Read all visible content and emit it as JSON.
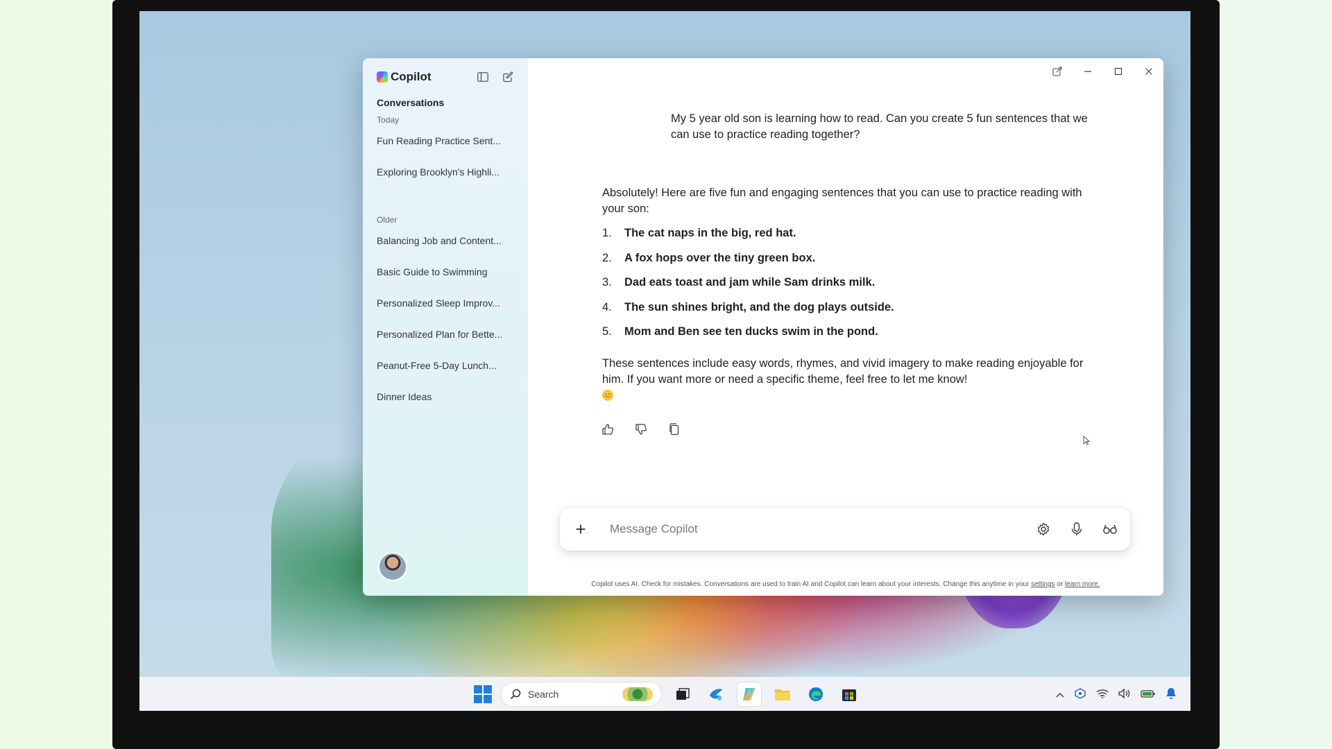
{
  "app": {
    "title": "Copilot"
  },
  "sidebar": {
    "heading": "Conversations",
    "groups": [
      {
        "label": "Today",
        "items": [
          "Fun Reading Practice Sent...",
          "Exploring Brooklyn's Highli..."
        ]
      },
      {
        "label": "Older",
        "items": [
          "Balancing Job and Content...",
          "Basic Guide to Swimming",
          "Personalized Sleep Improv...",
          "Personalized Plan for Bette...",
          "Peanut-Free 5-Day Lunch...",
          "Dinner Ideas"
        ]
      }
    ]
  },
  "chat": {
    "user_message": "My 5 year old son is learning how to read. Can you create 5 fun sentences that we can use to practice reading together?",
    "reply_intro": "Absolutely! Here are five fun and engaging sentences that you can use to practice reading with your son:",
    "sentences": [
      {
        "num": "1.",
        "text": "The cat naps in the big, red hat."
      },
      {
        "num": "2.",
        "text": "A fox hops over the tiny green box."
      },
      {
        "num": "3.",
        "text": "Dad eats toast and jam while Sam drinks milk."
      },
      {
        "num": "4.",
        "text": "The sun shines bright, and the dog plays outside."
      },
      {
        "num": "5.",
        "text": "Mom and Ben see ten ducks swim in the pond."
      }
    ],
    "reply_outro": "These sentences include easy words, rhymes, and vivid imagery to make reading enjoyable for him. If you want more or need a specific theme, feel free to let me know!",
    "emoji": "😊"
  },
  "composer": {
    "placeholder": "Message Copilot"
  },
  "disclaimer": {
    "text": "Copilot uses AI. Check for mistakes. Conversations are used to train AI and Copilot can learn about your interests. Change this anytime in your",
    "settings_link": "settings",
    "or": "or",
    "learn_more_link": "learn more."
  },
  "taskbar": {
    "search_label": "Search"
  },
  "icons": {
    "sidebar_toggle": "sidebar-toggle-icon",
    "new_chat": "new-chat-icon",
    "thumbs_up": "thumbs-up-icon",
    "thumbs_down": "thumbs-down-icon",
    "copy": "copy-icon",
    "plus": "plus-icon",
    "settings": "gear-icon",
    "microphone": "microphone-icon",
    "vision": "glasses-icon"
  },
  "colors": {
    "accent": "#1e7fe0",
    "sidebar_bg": "#e6f3f8"
  }
}
